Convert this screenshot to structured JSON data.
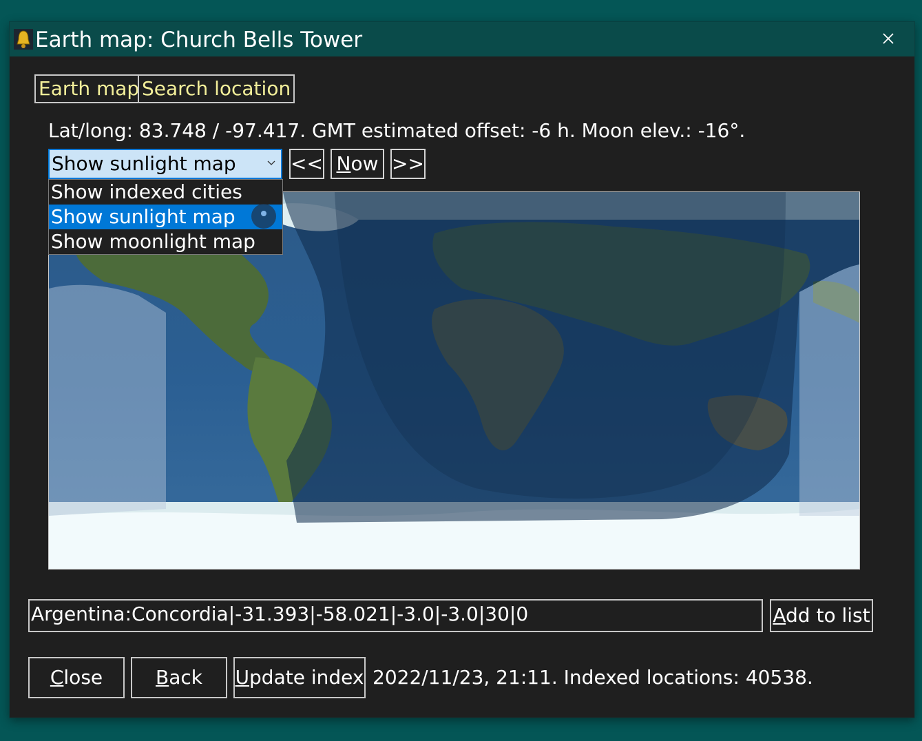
{
  "window": {
    "title": "Earth map: Church Bells Tower",
    "icon": "bell-icon",
    "close_icon": "close-icon"
  },
  "tabs": [
    {
      "label": "Earth map"
    },
    {
      "label": "Search location"
    }
  ],
  "info_line": "Lat/long: 83.748 / -97.417. GMT estimated offset: -6 h. Moon elev.: -16°.",
  "map_mode": {
    "selected": "Show sunlight map",
    "options": [
      "Show indexed cities",
      "Show sunlight map",
      "Show moonlight map"
    ],
    "highlighted_index": 1
  },
  "nav": {
    "prev_label": "<<",
    "now_label_accel": "N",
    "now_label_rest": "ow",
    "next_label": ">>"
  },
  "location_input": {
    "value": "Argentina:Concordia|-31.393|-58.021|-3.0|-3.0|30|0"
  },
  "buttons": {
    "add_accel": "A",
    "add_rest": "dd to list",
    "close_accel": "C",
    "close_rest": "lose",
    "back_accel": "B",
    "back_rest": "ack",
    "update_accel": "U",
    "update_rest": "pdate index"
  },
  "status": "2022/11/23, 21:11. Indexed locations: 40538.",
  "colors": {
    "titlebar": "#0a4b4a",
    "window_bg": "#1f1f1f",
    "tab_text": "#f3ef9a",
    "selection": "#0078d7",
    "select_bg": "#cce4f7",
    "night_overlay": "#0f2a4a"
  }
}
